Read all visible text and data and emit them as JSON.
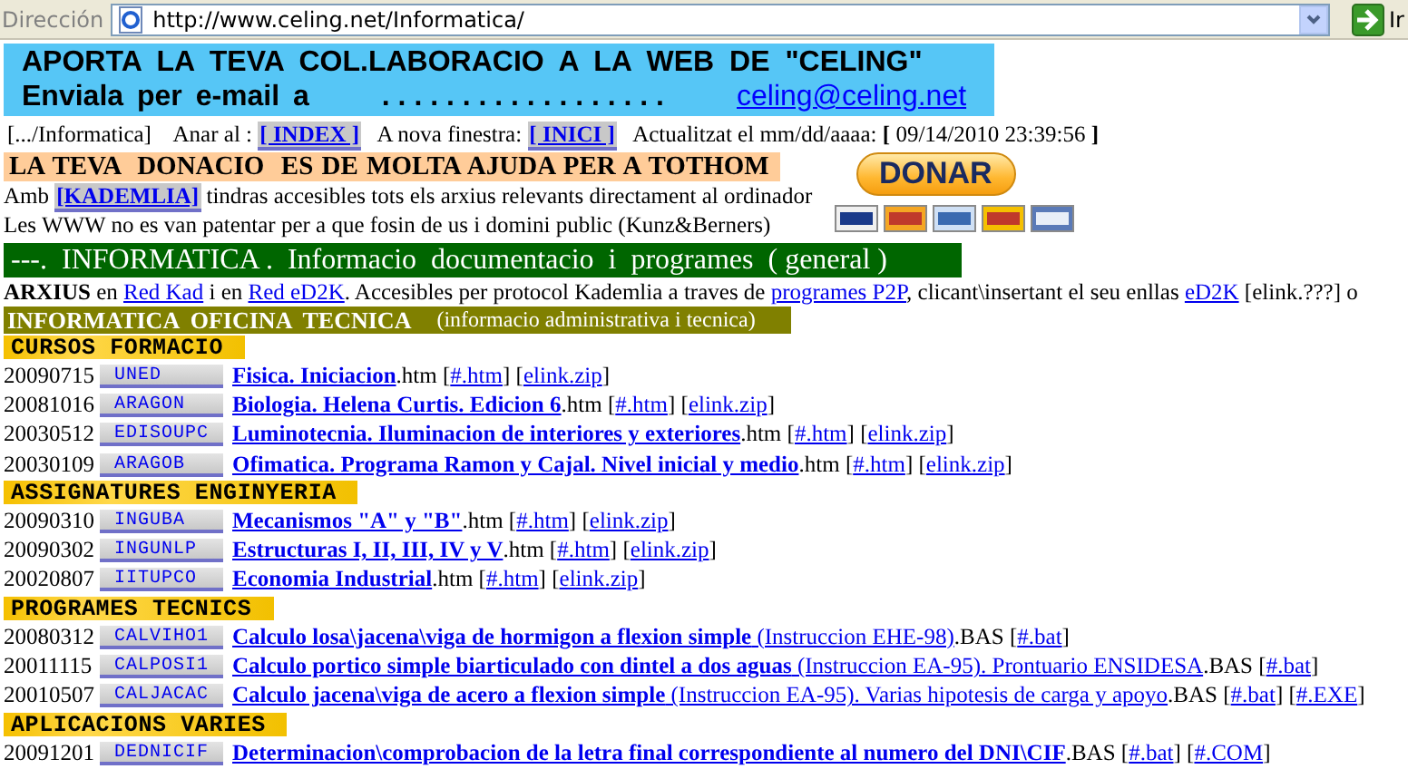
{
  "address_bar": {
    "label": "Dirección",
    "url": "http://www.celing.net/Informatica/",
    "go": "Ir"
  },
  "banner": {
    "line1": "APORTA LA TEVA COL.LABORACIO A LA WEB DE \"CELING\"",
    "line2": "Enviala per e-mail a",
    "dots": ". . . . . . . . . . . . . . . . . .",
    "email": "celing@celing.net"
  },
  "info_line": [
    {
      "kind": "text",
      "text": "[.../Informatica]    Anar al : "
    },
    {
      "kind": "button",
      "text": "[ INDEX ]"
    },
    {
      "kind": "text",
      "text": "   A nova finestra: "
    },
    {
      "kind": "button",
      "text": "[ INICI ]"
    },
    {
      "kind": "text",
      "text": "   Actualitzat el mm/dd/aaaa: "
    },
    {
      "kind": "bold",
      "text": "["
    },
    {
      "kind": "text",
      "text": " 09/14/2010 23:39:56 "
    },
    {
      "kind": "bold",
      "text": "]"
    }
  ],
  "donation": {
    "text": "LA TEVA  DONACIO  ES DE MOLTA AJUDA PER A TOTHOM",
    "button": "DONAR"
  },
  "kademlia_line": [
    {
      "kind": "text",
      "text": "Amb "
    },
    {
      "kind": "button",
      "text": "[KADEMLIA]"
    },
    {
      "kind": "text",
      "text": " tindras accesibles tots els arxius relevants directament al ordinador"
    }
  ],
  "www_line": "Les WWW no es van patentar per a que fosin de us i domini public (Kunz&Berners)",
  "category_bar": "---.  INFORMATICA .  Informacio  documentacio  i  programes  ( general )",
  "arxius_line": [
    {
      "kind": "bold",
      "text": "ARXIUS"
    },
    {
      "kind": "text",
      "text": " en "
    },
    {
      "kind": "link",
      "text": "Red Kad"
    },
    {
      "kind": "text",
      "text": " i en "
    },
    {
      "kind": "link",
      "text": "Red eD2K"
    },
    {
      "kind": "text",
      "text": ". Accesibles per protocol Kademlia a traves de "
    },
    {
      "kind": "link",
      "text": "programes P2P"
    },
    {
      "kind": "text",
      "text": ", clicant\\insertant el seu enllas "
    },
    {
      "kind": "link",
      "text": "eD2K"
    },
    {
      "kind": "text",
      "text": " [elink.???] o"
    }
  ],
  "office_bar": {
    "title": "INFORMATICA  OFICINA  TECNICA",
    "subtitle": "(informacio administrativa i tecnica)"
  },
  "sections": [
    {
      "title": "CURSOS FORMACIO",
      "entries": [
        {
          "date": "20090715",
          "code": "UNED",
          "title": "Fisica. Iniciacion",
          "suffix": ".htm",
          "links": [
            "[#.htm]",
            "[elink.zip]"
          ]
        },
        {
          "date": "20081016",
          "code": "ARAGON",
          "title": "Biologia. Helena Curtis. Edicion 6",
          "suffix": ".htm",
          "links": [
            "[#.htm]",
            "[elink.zip]"
          ]
        },
        {
          "date": "20030512",
          "code": "EDISOUPC",
          "title": "Luminotecnia. Iluminacion de interiores y exteriores",
          "suffix": ".htm",
          "links": [
            "[#.htm]",
            "[elink.zip]"
          ]
        },
        {
          "date": "20030109",
          "code": "ARAGOB",
          "title": "Ofimatica. Programa Ramon y Cajal. Nivel inicial y medio",
          "suffix": ".htm",
          "links": [
            "[#.htm]",
            "[elink.zip]"
          ]
        }
      ]
    },
    {
      "title": "ASSIGNATURES ENGINYERIA",
      "entries": [
        {
          "date": "20090310",
          "code": "INGUBA",
          "title": "Mecanismos \"A\" y \"B\"",
          "suffix": ".htm",
          "links": [
            "[#.htm]",
            "[elink.zip]"
          ]
        },
        {
          "date": "20090302",
          "code": "INGUNLP",
          "title": "Estructuras I, II, III, IV y V",
          "suffix": ".htm",
          "links": [
            "[#.htm]",
            "[elink.zip]"
          ]
        },
        {
          "date": "20020807",
          "code": "IITUPCO",
          "title": "Economia Industrial",
          "suffix": ".htm",
          "links": [
            "[#.htm]",
            "[elink.zip]"
          ]
        }
      ]
    },
    {
      "title": "PROGRAMES TECNICS",
      "entries": [
        {
          "date": "20080312",
          "code": "CALVIHO1",
          "title": "Calculo losa\\jacena\\viga de hormigon a flexion simple",
          "note": " (Instruccion EHE-98)",
          "suffix": ".BAS",
          "links": [
            "[#.bat]"
          ]
        },
        {
          "date": "20011115",
          "code": "CALPOSI1",
          "title": "Calculo portico simple biarticulado con dintel a dos aguas",
          "note": " (Instruccion EA-95). Prontuario ENSIDESA",
          "suffix": ".BAS",
          "links": [
            "[#.bat]"
          ]
        },
        {
          "date": "20010507",
          "code": "CALJACAC",
          "title": "Calculo jacena\\viga de acero a flexion simple",
          "note": " (Instruccion EA-95). Varias hipotesis de carga y apoyo",
          "suffix": ".BAS",
          "links": [
            "[#.bat]",
            "[#.EXE]"
          ]
        }
      ]
    },
    {
      "title": "APLICACIONS VARIES",
      "entries": [
        {
          "date": "20091201",
          "code": "DEDNICIF",
          "title": "Determinacion\\comprobacion de la letra final correspondiente al numero del DNI\\CIF",
          "suffix": ".BAS",
          "links": [
            "[#.bat]",
            "[#.COM]"
          ]
        }
      ]
    }
  ]
}
